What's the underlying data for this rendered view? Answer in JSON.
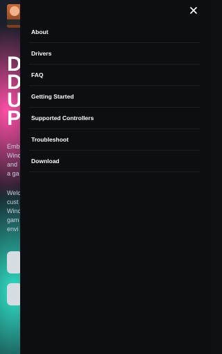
{
  "page": {
    "heading_lines": [
      "D",
      "D",
      "U",
      "P"
    ],
    "para1_lines": [
      "Emb",
      "Winc",
      "and",
      "a ga"
    ],
    "para2_lines": [
      "Welc",
      "cust",
      "Winc",
      "gam",
      "envi"
    ]
  },
  "drawer": {
    "close_icon": "close-icon",
    "menu": [
      "About",
      "Drivers",
      "FAQ",
      "Getting Started",
      "Supported Controllers",
      "Troubleshoot",
      "Download"
    ]
  }
}
